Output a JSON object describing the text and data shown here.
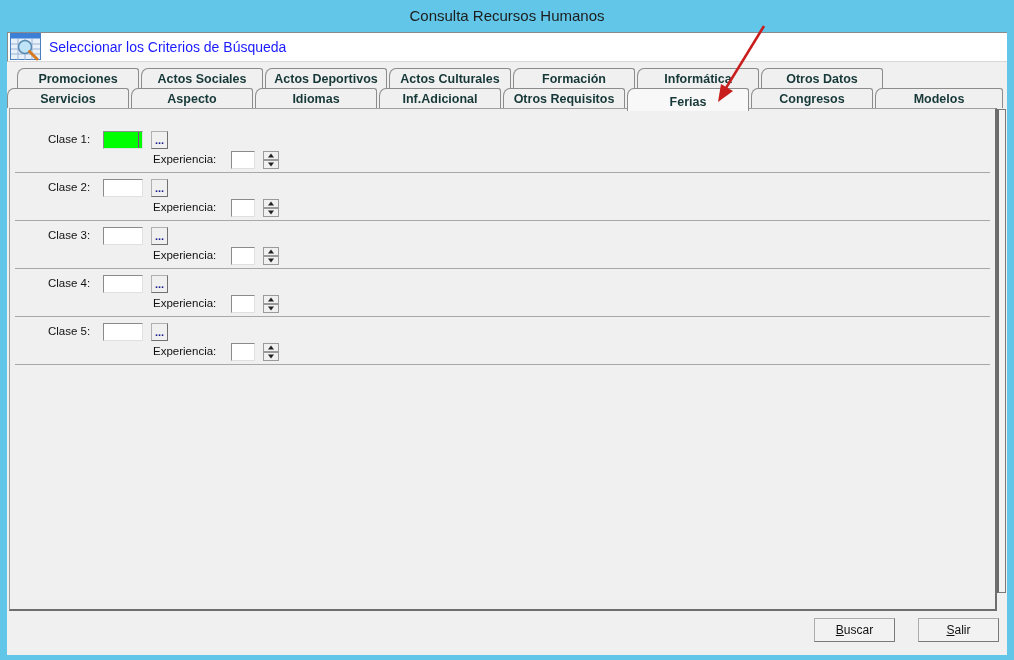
{
  "window": {
    "title": "Consulta Recursos Humanos"
  },
  "header": {
    "title": "Seleccionar los Criterios de Búsqueda"
  },
  "tab_rows": [
    {
      "tabs": [
        {
          "label": "Promociones",
          "selected": false
        },
        {
          "label": "Actos Sociales",
          "selected": false
        },
        {
          "label": "Actos Deportivos",
          "selected": false
        },
        {
          "label": "Actos Culturales",
          "selected": false
        },
        {
          "label": "Formación",
          "selected": false
        },
        {
          "label": "Informática",
          "selected": false
        },
        {
          "label": "Otros Datos",
          "selected": false
        }
      ]
    },
    {
      "tabs": [
        {
          "label": "Servicios",
          "selected": false
        },
        {
          "label": "Aspecto",
          "selected": false
        },
        {
          "label": "Idiomas",
          "selected": false
        },
        {
          "label": "Inf.Adicional",
          "selected": false
        },
        {
          "label": "Otros Requisitos",
          "selected": false
        },
        {
          "label": "Ferias",
          "selected": true
        },
        {
          "label": "Congresos",
          "selected": false
        },
        {
          "label": "Modelos",
          "selected": false
        }
      ]
    }
  ],
  "criteria": [
    {
      "label": "Clase 1:",
      "focused": true,
      "browse_button": "...",
      "experience_label": "Experiencia:"
    },
    {
      "label": "Clase 2:",
      "focused": false,
      "browse_button": "...",
      "experience_label": "Experiencia:"
    },
    {
      "label": "Clase 3:",
      "focused": false,
      "browse_button": "...",
      "experience_label": "Experiencia:"
    },
    {
      "label": "Clase 4:",
      "focused": false,
      "browse_button": "...",
      "experience_label": "Experiencia:"
    },
    {
      "label": "Clase 5:",
      "focused": false,
      "browse_button": "...",
      "experience_label": "Experiencia:"
    }
  ],
  "buttons": [
    {
      "label": "Buscar",
      "access_key_underlined": true
    },
    {
      "label": "Salir",
      "access_key_underlined": true
    }
  ],
  "annotations": [
    {
      "kind": "arrow"
    }
  ]
}
